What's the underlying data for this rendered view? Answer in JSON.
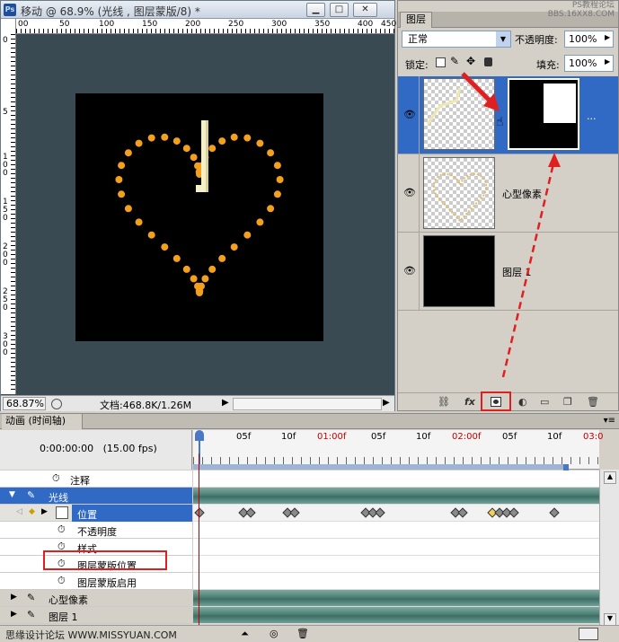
{
  "document": {
    "title": "移动 @ 68.9% (光线 , 图层蒙版/8) *",
    "ruler_top": [
      "00",
      "50",
      "100",
      "150",
      "200",
      "250",
      "300",
      "350",
      "400",
      "450"
    ],
    "ruler_left": [
      "0",
      "5",
      "100",
      "150",
      "200",
      "250",
      "300",
      "350",
      "400",
      "450"
    ],
    "zoom": "68.87%",
    "doc_info": "文档:468.8K/1.26M"
  },
  "layers_panel": {
    "tab_label": "图层",
    "watermark_line1": "PS教程论坛",
    "watermark_line2": "BBS.16XX8.COM",
    "blend_mode": "正常",
    "opacity_label": "不透明度:",
    "opacity_value": "100%",
    "lock_label": "锁定:",
    "fill_label": "填充:",
    "fill_value": "100%",
    "layers": [
      {
        "name": ""
      },
      {
        "name": "心型像素"
      },
      {
        "name": "图层 1"
      }
    ]
  },
  "timeline": {
    "tab_label": "动画 (时间轴)",
    "timecode": "0:00:00:00",
    "fps": "(15.00 fps)",
    "ruler_labels": [
      {
        "text": "05f",
        "red": false
      },
      {
        "text": "10f",
        "red": false
      },
      {
        "text": "01:00f",
        "red": true
      },
      {
        "text": "05f",
        "red": false
      },
      {
        "text": "10f",
        "red": false
      },
      {
        "text": "02:00f",
        "red": true
      },
      {
        "text": "05f",
        "red": false
      },
      {
        "text": "10f",
        "red": false
      },
      {
        "text": "03:0",
        "red": true
      }
    ],
    "rows": {
      "notes": "注释",
      "light": "光线",
      "position": "位置",
      "opacity": "不透明度",
      "style": "样式",
      "mask_position": "图层蒙版位置",
      "mask_enable": "图层蒙版启用",
      "heart": "心型像素",
      "layer1": "图层 1"
    },
    "footer_watermark": "思缘设计论坛 WWW.MISSYUAN.COM"
  }
}
